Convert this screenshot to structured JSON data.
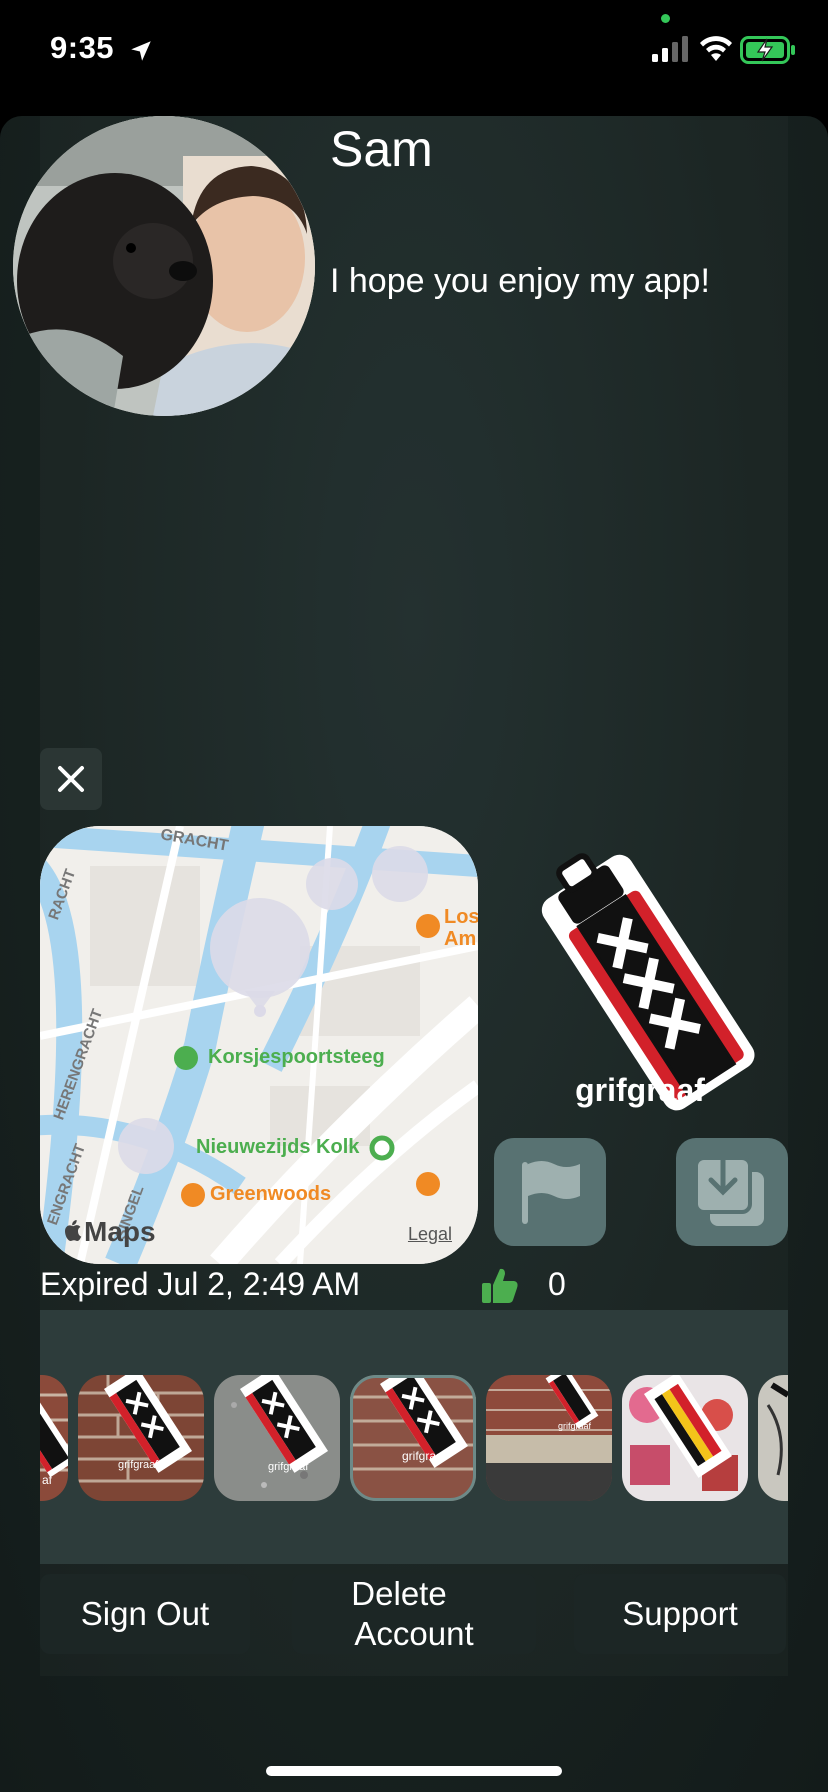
{
  "status_bar": {
    "time": "9:35",
    "icons": [
      "location-arrow-icon",
      "cellular-signal-icon",
      "wifi-icon",
      "battery-charging-icon"
    ]
  },
  "profile": {
    "name": "Sam",
    "bio": "I hope you enjoy my app!"
  },
  "map": {
    "labels": {
      "street_top": "GRACHT",
      "street_left": "RACHT",
      "herengracht": "HERENGRACHT",
      "engracht": "ENGRACHT",
      "singel": "SINGEL",
      "korsjespoortsteeg": "Korsjespoortsteeg",
      "nieuwezijds_kolk": "Nieuwezijds Kolk",
      "greenwoods": "Greenwoods",
      "los": "Los",
      "am": "Am"
    },
    "brand": "Maps",
    "legal": "Legal"
  },
  "tag": {
    "name": "grifgraaf"
  },
  "post": {
    "expired_text": "Expired Jul 2, 2:49 AM",
    "like_count": "0"
  },
  "thumbnails": [
    {
      "caption": "af"
    },
    {
      "caption": "grifgraaf"
    },
    {
      "caption": "grifgraaf"
    },
    {
      "caption": "grifgraaf"
    },
    {
      "caption": "grifgraaf"
    },
    {
      "caption": ""
    },
    {
      "caption": ""
    }
  ],
  "buttons": {
    "sign_out": "Sign Out",
    "delete_line1": "Delete",
    "delete_line2": "Account",
    "support": "Support"
  },
  "colors": {
    "accent_green": "#4cae4f",
    "tag_red": "#d2212a",
    "map_water": "#a8d4ef",
    "button_teal": "#587272"
  }
}
